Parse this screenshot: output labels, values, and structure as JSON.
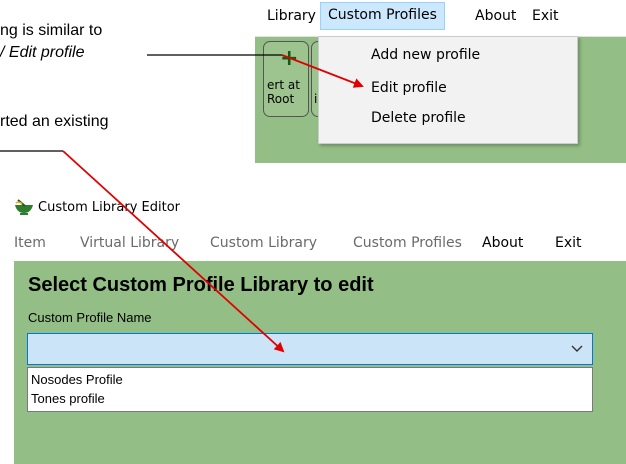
{
  "annotation": {
    "line1": "ng is similar to",
    "line2": "/ Edit profile",
    "line3": "rted an existing"
  },
  "top_menu": {
    "items": [
      "Library",
      "Custom Profiles",
      "About",
      "Exit"
    ]
  },
  "toolbar": {
    "button1_line1": "ert at",
    "button1_line2": "Root",
    "button2_label": "i"
  },
  "dropdown": {
    "items": [
      "Add new profile",
      "Edit profile",
      "Delete profile"
    ]
  },
  "window": {
    "title": "Custom Library Editor"
  },
  "menu": {
    "items": [
      "Item",
      "Virtual Library",
      "Custom Library",
      "Custom Profiles",
      "About",
      "Exit"
    ]
  },
  "main": {
    "heading": "Select Custom Profile Library to edit",
    "field_label": "Custom Profile Name",
    "combo_value": "",
    "options": [
      "Nosodes Profile",
      "Tones profile"
    ]
  },
  "colors": {
    "green_bg": "#93be85",
    "arrow": "#e00000",
    "highlight": "#cce8ff"
  }
}
